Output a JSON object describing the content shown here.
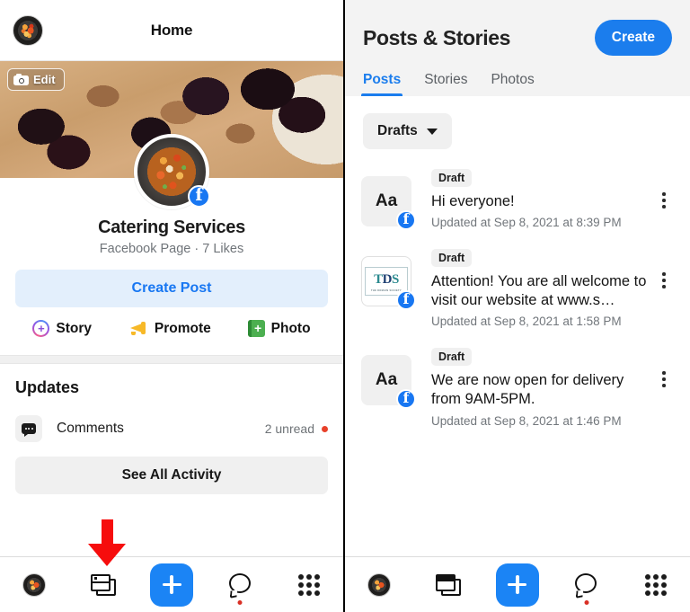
{
  "left": {
    "topbar": {
      "title": "Home",
      "avatar_icon": "profile-avatar"
    },
    "cover": {
      "edit_label": "Edit",
      "camera_icon": "camera-icon"
    },
    "profile": {
      "name": "Catering Services",
      "meta": "Facebook Page · 7 Likes",
      "badge_icon": "facebook-badge-icon",
      "create_post_label": "Create Post"
    },
    "quick_actions": [
      {
        "label": "Story",
        "icon": "story-plus-icon"
      },
      {
        "label": "Promote",
        "icon": "megaphone-icon"
      },
      {
        "label": "Photo",
        "icon": "photo-plus-icon"
      }
    ],
    "updates": {
      "title": "Updates",
      "comments_label": "Comments",
      "comments_icon": "comment-bubble-icon",
      "unread_text": "2 unread",
      "unread_dot_color": "#e8412b",
      "see_all_label": "See All Activity"
    },
    "annotation": {
      "arrow_icon": "red-down-arrow",
      "color": "#f60d0d"
    },
    "bottomnav": [
      {
        "icon": "profile-avatar-nav-icon"
      },
      {
        "icon": "pages-icon"
      },
      {
        "icon": "plus-create-icon"
      },
      {
        "icon": "messenger-chat-icon"
      },
      {
        "icon": "grid-menu-icon"
      }
    ]
  },
  "right": {
    "header": {
      "title": "Posts & Stories",
      "create_label": "Create",
      "accent_color": "#1b7ded"
    },
    "tabs": [
      {
        "label": "Posts",
        "active": true
      },
      {
        "label": "Stories",
        "active": false
      },
      {
        "label": "Photos",
        "active": false
      }
    ],
    "filter": {
      "label": "Drafts",
      "caret_icon": "chevron-down-icon"
    },
    "posts": [
      {
        "thumb_type": "Aa",
        "badge": "Draft",
        "text": "Hi everyone!",
        "time": "Updated at Sep 8, 2021 at 8:39 PM",
        "menu_icon": "kebab-menu-icon",
        "platform_icon": "facebook-badge-icon"
      },
      {
        "thumb_type": "TDS",
        "thumb_letters_t": "T",
        "thumb_letters_d": "D",
        "thumb_letters_s": "S",
        "thumb_subtext": "THE DOMAIN SOCIETY",
        "badge": "Draft",
        "text": "Attention! You are all welcome to visit our website at www.s…",
        "time": "Updated at Sep 8, 2021 at 1:58 PM",
        "menu_icon": "kebab-menu-icon",
        "platform_icon": "facebook-badge-icon"
      },
      {
        "thumb_type": "Aa",
        "badge": "Draft",
        "text": "We are now open for delivery from 9AM-5PM.",
        "time": "Updated at Sep 8, 2021 at 1:46 PM",
        "menu_icon": "kebab-menu-icon",
        "platform_icon": "facebook-badge-icon"
      }
    ],
    "bottomnav": [
      {
        "icon": "profile-avatar-nav-icon"
      },
      {
        "icon": "pages-icon-filled"
      },
      {
        "icon": "plus-create-icon"
      },
      {
        "icon": "messenger-chat-icon"
      },
      {
        "icon": "grid-menu-icon"
      }
    ]
  }
}
